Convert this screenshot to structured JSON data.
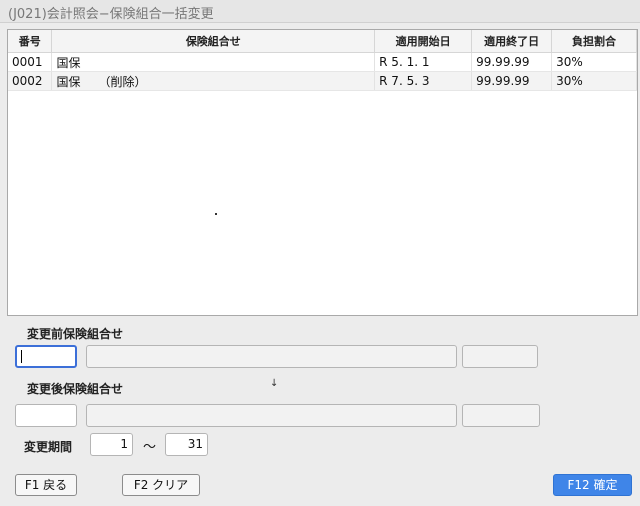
{
  "window": {
    "title": "(J021)会計照会−保険組合一括変更"
  },
  "grid": {
    "columns": [
      "番号",
      "保険組合せ",
      "適用開始日",
      "適用終了日",
      "負担割合"
    ],
    "rows": [
      [
        "0001",
        "国保",
        "R 5. 1. 1",
        "99.99.99",
        "30%"
      ],
      [
        "0002",
        "国保　　（削除）",
        "R 7. 5. 3",
        "99.99.99",
        "30%"
      ]
    ]
  },
  "before": {
    "label": "変更前保険組合せ"
  },
  "after": {
    "label": "変更後保険組合せ"
  },
  "arrow": "↓",
  "period": {
    "label": "変更期間",
    "from": "1",
    "separator": "〜",
    "to": "31"
  },
  "buttons": {
    "back": "F1 戻る",
    "clear": "F2 クリア",
    "confirm": "F12 確定"
  }
}
